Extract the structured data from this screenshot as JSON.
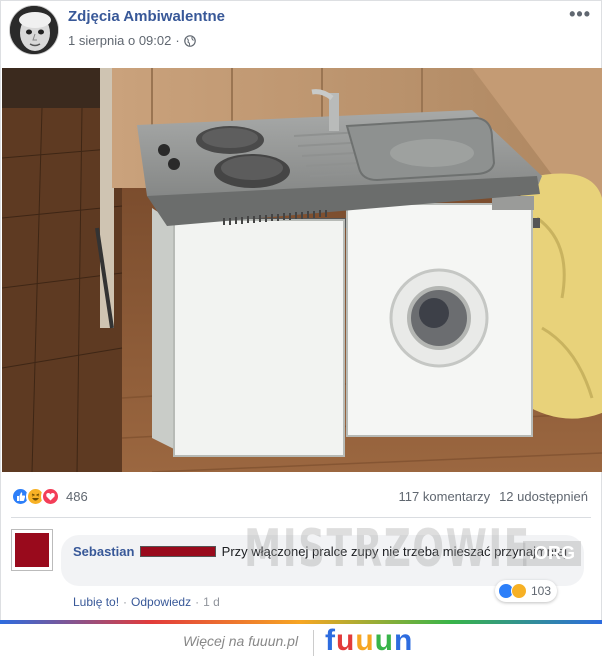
{
  "post": {
    "page_name": "Zdjęcia Ambiwalentne",
    "date": "1 sierpnia o 09:02",
    "separator": "·",
    "more": "•••"
  },
  "reactions": {
    "icons": [
      "like-icon",
      "haha-icon",
      "love-icon"
    ],
    "count": "486",
    "comments": "117 komentarzy",
    "shares": "12 udostępnień"
  },
  "comment": {
    "author": "Sebastian",
    "text": "Przy włączonej pralce zupy nie trzeba mieszać przynajmniej",
    "reaction_count": "103",
    "like": "Lubię to!",
    "reply": "Odpowiedz",
    "dot": "·",
    "time": "1 d"
  },
  "watermark": {
    "main": "MISTRZOWIE",
    "suffix": ".ORG"
  },
  "footer": {
    "text": "Więcej na fuuun.pl",
    "logo_letters": [
      "f",
      "u",
      "u",
      "u",
      "n"
    ]
  },
  "colors": {
    "link": "#385898",
    "redaction": "#990a1c",
    "like": "#2d7ff9",
    "haha": "#f7b125",
    "love": "#f33e58"
  }
}
